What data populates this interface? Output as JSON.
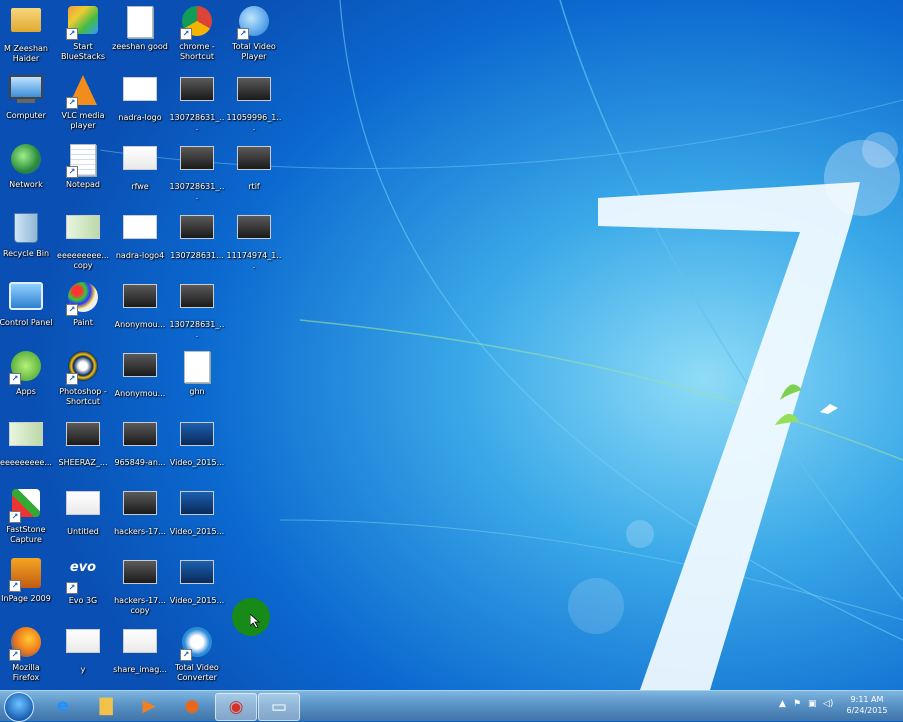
{
  "desktop": {
    "columns": [
      [
        {
          "label": "M Zeeshan Haider",
          "icon": "folder-icon"
        },
        {
          "label": "Computer",
          "icon": "computer-icon"
        },
        {
          "label": "Network",
          "icon": "network-icon"
        },
        {
          "label": "Recycle Bin",
          "icon": "recycle-bin-icon"
        },
        {
          "label": "Control Panel",
          "icon": "control-panel-icon"
        },
        {
          "label": "Apps",
          "icon": "apps-icon"
        },
        {
          "label": "eeeeeeeee...",
          "icon": "id-card-image-icon"
        },
        {
          "label": "FastStone Capture",
          "icon": "faststone-icon"
        },
        {
          "label": "InPage 2009",
          "icon": "inpage-icon"
        },
        {
          "label": "Mozilla Firefox",
          "icon": "firefox-icon"
        }
      ],
      [
        {
          "label": "Start BlueStacks",
          "icon": "bluestacks-icon"
        },
        {
          "label": "VLC media player",
          "icon": "vlc-icon"
        },
        {
          "label": "Notepad",
          "icon": "notepad-icon"
        },
        {
          "label": "eeeeeeeee... copy",
          "icon": "id-card-image-icon"
        },
        {
          "label": "Paint",
          "icon": "paint-icon"
        },
        {
          "label": "Photoshop - Shortcut",
          "icon": "photoshop-icon"
        },
        {
          "label": "SHEERAZ_...",
          "icon": "photo-icon"
        },
        {
          "label": "Untitled",
          "icon": "image-icon"
        },
        {
          "label": "Evo 3G",
          "icon": "evo-icon"
        },
        {
          "label": "y",
          "icon": "image-icon"
        }
      ],
      [
        {
          "label": "zeeshan good",
          "icon": "text-document-icon"
        },
        {
          "label": "nadra-logo",
          "icon": "logo-image-icon"
        },
        {
          "label": "rfwe",
          "icon": "image-icon"
        },
        {
          "label": "nadra-logo4",
          "icon": "logo-image-icon"
        },
        {
          "label": "Anonymou...",
          "icon": "photo-icon"
        },
        {
          "label": "Anonymou...",
          "icon": "photo-icon"
        },
        {
          "label": "965849-an...",
          "icon": "photo-icon"
        },
        {
          "label": "hackers-17...",
          "icon": "photo-icon"
        },
        {
          "label": "hackers-17... copy",
          "icon": "photo-icon"
        },
        {
          "label": "share_imag...",
          "icon": "image-icon"
        }
      ],
      [
        {
          "label": "chrome - Shortcut",
          "icon": "chrome-icon"
        },
        {
          "label": "130728631_...",
          "icon": "photo-icon"
        },
        {
          "label": "130728631_...",
          "icon": "photo-icon"
        },
        {
          "label": "130728631...",
          "icon": "photo-icon"
        },
        {
          "label": "130728631_...",
          "icon": "photo-icon"
        },
        {
          "label": "ghn",
          "icon": "text-document-icon"
        },
        {
          "label": "Video_2015...",
          "icon": "video-icon"
        },
        {
          "label": "Video_2015...",
          "icon": "video-icon"
        },
        {
          "label": "Video_2015...",
          "icon": "video-icon"
        },
        {
          "label": "Total Video Converter",
          "icon": "video-converter-icon"
        }
      ],
      [
        {
          "label": "Total Video Player",
          "icon": "video-player-icon"
        },
        {
          "label": "11059996_1...",
          "icon": "photo-icon"
        },
        {
          "label": "rtif",
          "icon": "photo-icon"
        },
        {
          "label": "11174974_1...",
          "icon": "photo-icon"
        }
      ]
    ]
  },
  "taskbar": {
    "items": [
      {
        "name": "internet-explorer-icon",
        "glyph": "e",
        "color": "#1e90ff"
      },
      {
        "name": "file-explorer-icon",
        "glyph": "▇",
        "color": "#f2c24d"
      },
      {
        "name": "media-player-icon",
        "glyph": "▶",
        "color": "#f08020"
      },
      {
        "name": "firefox-icon",
        "glyph": "●",
        "color": "#e8681a"
      },
      {
        "name": "chrome-icon",
        "glyph": "◉",
        "color": "#d93025"
      },
      {
        "name": "window-icon",
        "glyph": "▭",
        "color": "#ffffff"
      }
    ],
    "clock": {
      "time": "9:11 AM",
      "date": "6/24/2015"
    },
    "tray": [
      "▲",
      "⚑",
      "▣",
      "◁)"
    ]
  },
  "colors": {
    "wallpaper": "#0b63c9",
    "taskbar": "#5a93c6"
  }
}
